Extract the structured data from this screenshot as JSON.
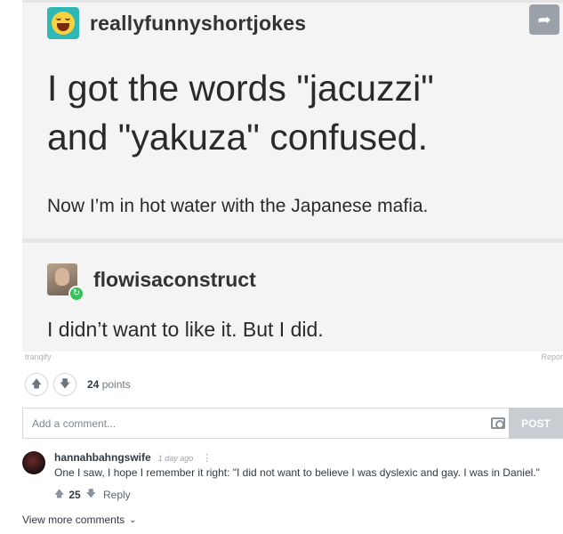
{
  "post": {
    "blog_name": "reallyfunnyshortjokes",
    "headline_line1": "I got the words \"jacuzzi\"",
    "headline_line2": "and \"yakuza\" confused.",
    "subline": "Now I’m in hot water with the Japanese mafia.",
    "reply_blog_name": "flowisaconstruct",
    "reply_text": "I didn’t want to like it. But I did."
  },
  "meta": {
    "source": "tranqify",
    "report": "Repor"
  },
  "votes": {
    "points_value": "24",
    "points_label": "points"
  },
  "comment_input": {
    "placeholder": "Add a comment...",
    "post_label": "POST"
  },
  "comments": [
    {
      "username": "hannahbahngswife",
      "time": "1 day ago",
      "text": "One I saw, I hope I remember it right: \"I did not want to believe I was dyslexic and gay. I was in Daniel.\"",
      "score": "25",
      "reply_label": "Reply"
    }
  ],
  "view_more_label": "View more comments",
  "icons": {
    "share": "share-arrow-icon",
    "upvote": "upvote-arrow-icon",
    "downvote": "downvote-arrow-icon",
    "camera": "camera-icon",
    "more": "vertical-dots-icon",
    "chevron": "chevron-down-icon",
    "reblog": "reblog-icon"
  },
  "colors": {
    "share_button": "#9aa1a8",
    "post_button": "#c9cdd1",
    "reblog_badge": "#34c25b",
    "avatar_bg": "#2fb7b5"
  }
}
